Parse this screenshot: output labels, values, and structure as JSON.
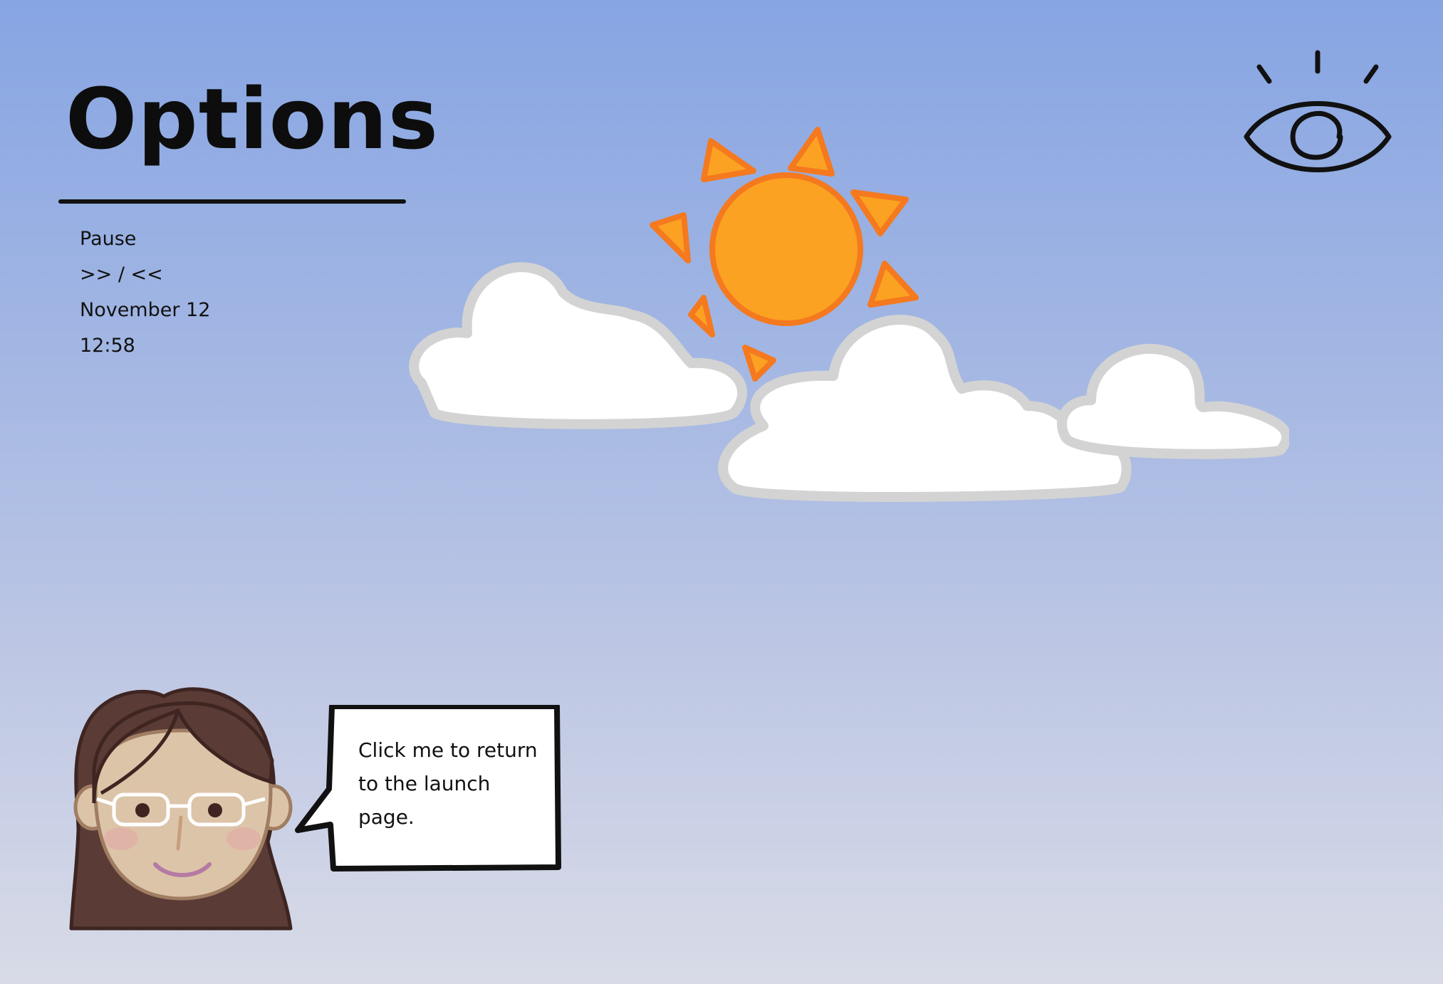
{
  "header": {
    "title": "Options"
  },
  "menu": {
    "items": [
      {
        "label": "Pause"
      },
      {
        "label": ">> / <<"
      },
      {
        "label": "November 12"
      },
      {
        "label": "12:58"
      }
    ]
  },
  "guide": {
    "speech": "Click me to return to the launch page."
  },
  "icons": {
    "eye": "eye-icon",
    "sun": "sun-icon",
    "cloud": "cloud-icon"
  },
  "colors": {
    "sky_top": "#87a5e3",
    "sky_bottom": "#d8dbe7",
    "sun_fill": "#fba222",
    "sun_outline": "#f5791f",
    "cloud_fill": "#ffffff",
    "cloud_outline": "#d3d3d3",
    "hair": "#5a3b35",
    "skin": "#dcc4a8"
  }
}
